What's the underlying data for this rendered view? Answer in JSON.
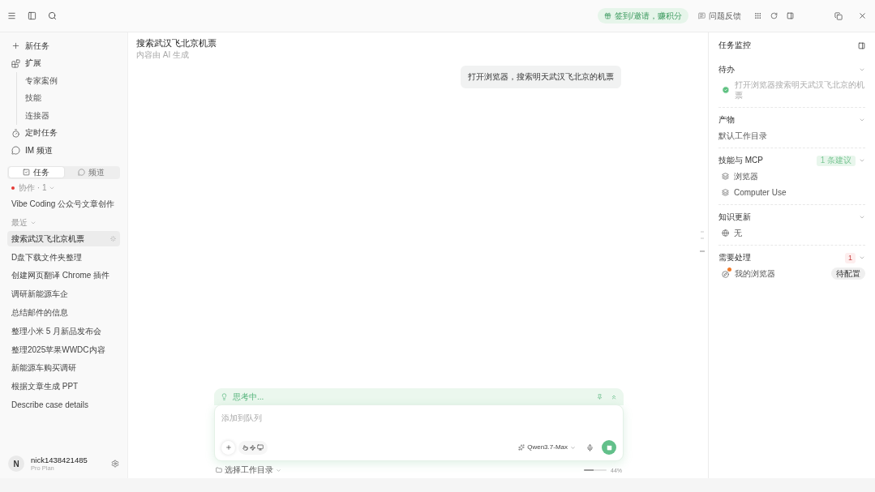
{
  "top_bar": {
    "promo": "签到/邀请，赚积分",
    "feedback": "问题反馈"
  },
  "sidebar": {
    "nav": [
      {
        "kind": "new",
        "label": "新任务"
      },
      {
        "kind": "extensions",
        "label": "扩展",
        "children": [
          {
            "label": "专家案例"
          },
          {
            "label": "技能"
          },
          {
            "label": "连接器"
          }
        ]
      },
      {
        "kind": "scheduled",
        "label": "定时任务"
      },
      {
        "kind": "im",
        "label": "IM 频道"
      }
    ],
    "tabs": [
      {
        "kind": "tasks",
        "label": "任务",
        "selected": true
      },
      {
        "kind": "channels",
        "label": "频道",
        "selected": false
      }
    ],
    "groups": [
      {
        "label": "协作 · 1",
        "alert": true,
        "expanded": true,
        "items": [
          {
            "label": "Vibe Coding 公众号文章创作",
            "selected": false,
            "running": false
          }
        ]
      },
      {
        "label": "最近",
        "alert": false,
        "expanded": true,
        "items": [
          {
            "label": "搜索武汉飞北京机票",
            "selected": true,
            "running": true
          },
          {
            "label": "D盘下载文件夹整理",
            "selected": false,
            "running": false
          },
          {
            "label": "创建网页翻译 Chrome 插件",
            "selected": false,
            "running": false
          },
          {
            "label": "调研新能源车企",
            "selected": false,
            "running": false
          },
          {
            "label": "总结邮件的信息",
            "selected": false,
            "running": false
          },
          {
            "label": "整理小米 5 月新品发布会",
            "selected": false,
            "running": false
          },
          {
            "label": "整理2025苹果WWDC内容",
            "selected": false,
            "running": false
          },
          {
            "label": "新能源车购买调研",
            "selected": false,
            "running": false
          },
          {
            "label": "根据文章生成 PPT",
            "selected": false,
            "running": false
          },
          {
            "label": "Describe case details",
            "selected": false,
            "running": false
          }
        ]
      }
    ],
    "user": {
      "avatar": "N",
      "name": "nick1438421485",
      "plan": "Pro Plan"
    }
  },
  "conversation": {
    "title": "搜索武汉飞北京机票",
    "subtitle": "内容由 AI 生成",
    "user_messages": [
      "打开浏览器，搜索明天武汉飞北京的机票"
    ]
  },
  "composer": {
    "status": "思考中...",
    "placeholder": "添加到队列",
    "model": "Qwen3.7-Max",
    "workdir": "选择工作目录",
    "context": {
      "level": 0.44,
      "reading": "44%"
    }
  },
  "monitor": {
    "title": "任务监控",
    "sections": [
      {
        "kind": "todo",
        "title": "待办",
        "expanded": true,
        "items": [
          {
            "label": "打开浏览器搜索明天武汉飞北京的机票",
            "done": true
          }
        ]
      },
      {
        "kind": "artifacts",
        "title": "产物",
        "expanded": true,
        "items": [
          {
            "label": "默认工作目录"
          }
        ]
      },
      {
        "kind": "skills",
        "title": "技能与 MCP",
        "expanded": true,
        "badge": {
          "kind": "suggestion",
          "text": "1 条建议"
        },
        "items": [
          {
            "label": "浏览器"
          },
          {
            "label": "Computer Use"
          }
        ]
      },
      {
        "kind": "knowledge",
        "title": "知识更新",
        "expanded": true,
        "items": [
          {
            "label": "无"
          }
        ]
      },
      {
        "kind": "action",
        "title": "需要处理",
        "expanded": true,
        "badge": {
          "kind": "alert",
          "text": "1"
        },
        "items": [
          {
            "label": "我的浏览器",
            "action": "待配置",
            "alert": true
          }
        ]
      }
    ]
  }
}
